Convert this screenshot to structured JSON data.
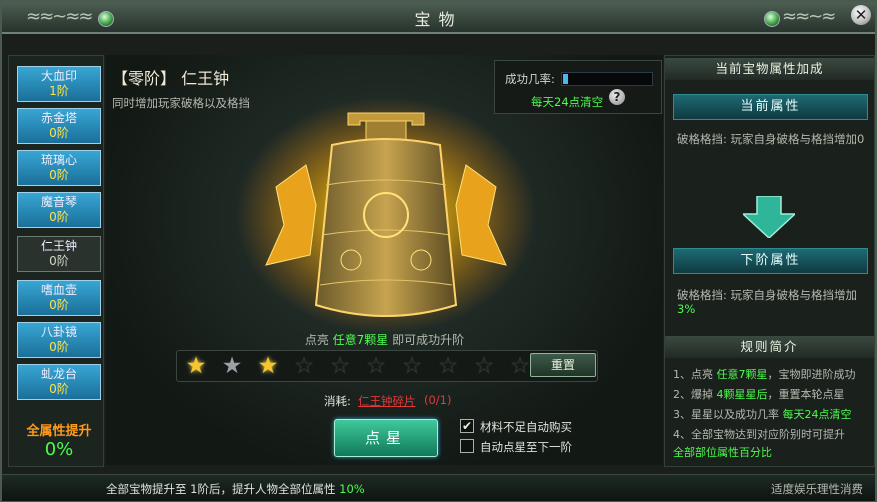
{
  "window": {
    "title": "宝物"
  },
  "treasures": [
    {
      "name": "大血印",
      "level": "1阶"
    },
    {
      "name": "赤金塔",
      "level": "0阶"
    },
    {
      "name": "琉璃心",
      "level": "0阶"
    },
    {
      "name": "魔音琴",
      "level": "0阶"
    },
    {
      "name": "仁王钟",
      "level": "0阶",
      "selected": true
    },
    {
      "name": "嗜血壶",
      "level": "0阶"
    },
    {
      "name": "八卦镜",
      "level": "0阶"
    },
    {
      "name": "虬龙台",
      "level": "0阶"
    }
  ],
  "all_attr": {
    "label": "全属性提升",
    "value": "0%"
  },
  "item": {
    "name": "【零阶】 仁王钟",
    "desc": "同时增加玩家破格以及格挡"
  },
  "success_rate": {
    "label": "成功几率:",
    "fraction": 0.06,
    "reset_note": "每天24点清空"
  },
  "hint": {
    "prefix": "点亮 ",
    "highlight": "任意7颗星",
    "suffix": " 即可成功升阶"
  },
  "stars": {
    "total": 10,
    "states": [
      "on",
      "half",
      "on",
      "off",
      "off",
      "off",
      "off",
      "off",
      "off",
      "off"
    ]
  },
  "reset_button": "重置",
  "cost": {
    "label": "消耗:",
    "item": "仁王钟碎片",
    "count": "(0/1)"
  },
  "star_button": "点星",
  "checkboxes": [
    {
      "label": "材料不足自动购买",
      "checked": true
    },
    {
      "label": "自动点星至下一阶",
      "checked": false
    }
  ],
  "right": {
    "title": "当前宝物属性加成",
    "current_title": "当前属性",
    "current_key": "破格格挡:",
    "current_value": "玩家自身破格与格挡增加0",
    "next_title": "下阶属性",
    "next_key": "破格格挡:",
    "next_value_text": "玩家自身破格与格挡增加",
    "next_value_pct": "3%",
    "rules_title": "规则简介",
    "rules": [
      {
        "a": "1、点亮 ",
        "g": "任意7颗星",
        "b": "，宝物即进阶成功"
      },
      {
        "a": "2、爆掉 ",
        "g": "4颗星星后",
        "b": "，重置本轮点星"
      },
      {
        "a": "3、星星以及成功几率 ",
        "g": "每天24点清空",
        "b": ""
      },
      {
        "a": "4、全部宝物达到对应阶别时可提升",
        "g": "",
        "b": ""
      },
      {
        "a": "    ",
        "g": "全部部位属性百分比",
        "b": ""
      }
    ]
  },
  "bottom": {
    "text_a": "全部宝物提升至 1阶后，提升人物全部位属性 ",
    "text_pct": "10%",
    "slogan": "适度娱乐理性消费"
  },
  "colors": {
    "accent_green": "#4dfb4d",
    "star_gold": "#f8c62c",
    "cost_red": "#e43838",
    "button_blue": "#38a6d4"
  }
}
